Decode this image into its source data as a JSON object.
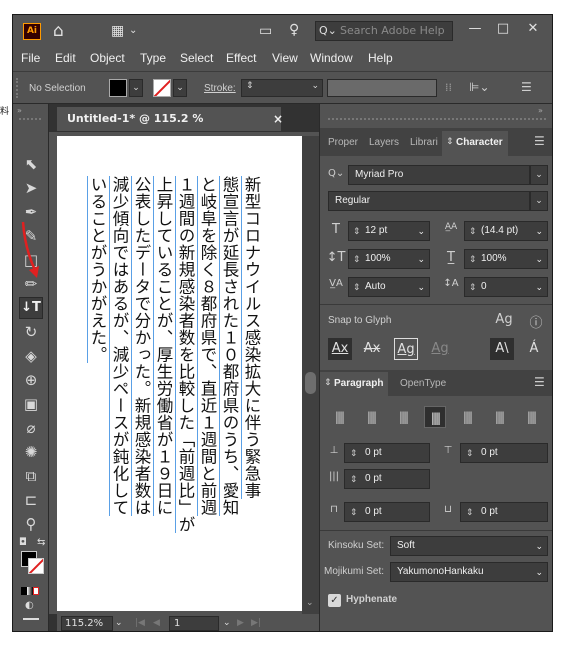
{
  "title_bar": {
    "logo": "Ai",
    "search_placeholder": "Search Adobe Help",
    "icons": [
      "home-icon",
      "workspace-icon",
      "arrange-icon",
      "lightbulb-icon",
      "search-icon",
      "minimize-icon",
      "maximize-icon",
      "close-icon"
    ]
  },
  "menu": [
    "File",
    "Edit",
    "Object",
    "Type",
    "Select",
    "Effect",
    "View",
    "Window",
    "Help"
  ],
  "control_bar": {
    "selection": "No Selection",
    "stroke_label": "Stroke:",
    "fill_color": "#000000"
  },
  "document": {
    "tab_title": "Untitled-1* @ 115.2 % (RGB/Previ...",
    "close": "×",
    "zoom": "115.2%",
    "page": "1",
    "lines": [
      "新型コロナウイルス感染拡大に伴う緊急事",
      "態宣言が延長された１０都府県のうち、愛知",
      "と岐阜を除く８都府県で、直近１週間と前週",
      "１週間の新規感染者数を比較した「前週比」が",
      "上昇していることが、厚生労働省が１９日に",
      "公表したデータで分かった。新規感染者数は",
      "減少傾向ではあるが、減少ペースが鈍化して",
      "いることがうかがえた。"
    ]
  },
  "panel_tabs": [
    "Proper",
    "Layers",
    "Librari",
    "Character"
  ],
  "character": {
    "font_family": "Myriad Pro",
    "font_style": "Regular",
    "font_size": "12 pt",
    "leading": "(14.4 pt)",
    "vscale": "100%",
    "hscale": "100%",
    "kerning": "Auto",
    "tracking": "0",
    "snap_label": "Snap to Glyph",
    "glyph_buttons": [
      "Ax",
      "Ax",
      "Ag",
      "Ag"
    ]
  },
  "paragraph": {
    "tabs": [
      "Paragraph",
      "OpenType"
    ],
    "indent_before": "0 pt",
    "indent_after": "0 pt",
    "first_line": "0 pt",
    "space_before": "0 pt",
    "space_after": "0 pt",
    "kinsoku_label": "Kinsoku Set:",
    "kinsoku_value": "Soft",
    "mojikumi_label": "Mojikumi Set:",
    "mojikumi_value": "YakumonoHankaku",
    "hyphenate_label": "Hyphenate"
  },
  "colors": {
    "accent_red": "#e02020",
    "ai_orange": "#ff9a00",
    "panel_bg": "#535353"
  }
}
